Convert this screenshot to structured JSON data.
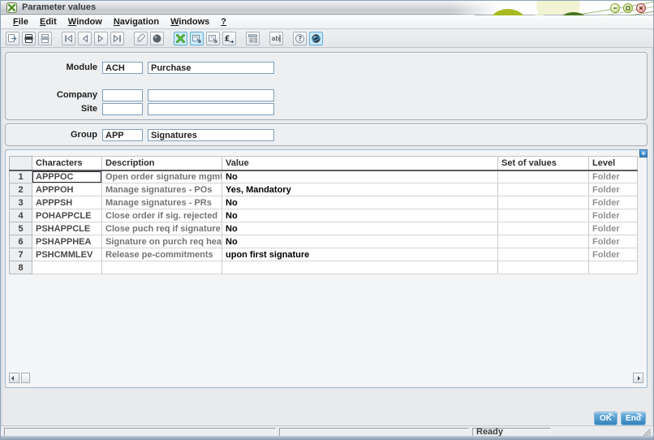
{
  "window": {
    "title": "Parameter values",
    "controls": {
      "minimize": "minimize",
      "maximize": "maximize",
      "close": "close"
    }
  },
  "menu": {
    "items": [
      "File",
      "Edit",
      "Window",
      "Navigation",
      "Windows",
      "?"
    ]
  },
  "toolbar": {
    "items": [
      {
        "name": "exit",
        "selected": false
      },
      {
        "name": "print",
        "selected": false
      },
      {
        "name": "print-list",
        "selected": false
      },
      {
        "name": "first-record",
        "selected": false
      },
      {
        "name": "previous-record",
        "selected": false
      },
      {
        "name": "next-record",
        "selected": false
      },
      {
        "name": "last-record",
        "selected": false
      },
      {
        "name": "attachments",
        "selected": false
      },
      {
        "name": "quick-help",
        "selected": false
      },
      {
        "name": "criteria",
        "selected": true
      },
      {
        "name": "selection-window",
        "selected": true
      },
      {
        "name": "copy-window",
        "selected": false
      },
      {
        "name": "currency-conversion",
        "selected": false
      },
      {
        "name": "list",
        "selected": false
      },
      {
        "name": "text-edit",
        "selected": false
      },
      {
        "name": "help",
        "selected": false
      },
      {
        "name": "web",
        "selected": true
      }
    ]
  },
  "form": {
    "module": {
      "label": "Module",
      "code": "ACH",
      "description": "Purchase"
    },
    "company": {
      "label": "Company",
      "code": "",
      "description": ""
    },
    "site": {
      "label": "Site",
      "code": "",
      "description": ""
    },
    "group": {
      "label": "Group",
      "code": "APP",
      "description": "Signatures"
    }
  },
  "table": {
    "columns": [
      "",
      "Characters",
      "Description",
      "Value",
      "Set of values",
      "Level"
    ],
    "rows": [
      {
        "num": "1",
        "characters": "APPPOC",
        "description": "Open order signature mgmt",
        "value": "No",
        "set_of_values": "",
        "level": "Folder"
      },
      {
        "num": "2",
        "characters": "APPPOH",
        "description": "Manage signatures - POs",
        "value": "Yes, Mandatory",
        "set_of_values": "",
        "level": "Folder"
      },
      {
        "num": "3",
        "characters": "APPPSH",
        "description": "Manage signatures - PRs",
        "value": "No",
        "set_of_values": "",
        "level": "Folder"
      },
      {
        "num": "4",
        "characters": "POHAPPCLE",
        "description": "Close order if sig. rejected",
        "value": "No",
        "set_of_values": "",
        "level": "Folder"
      },
      {
        "num": "5",
        "characters": "PSHAPPCLE",
        "description": "Close puch req if signature re",
        "value": "No",
        "set_of_values": "",
        "level": "Folder"
      },
      {
        "num": "6",
        "characters": "PSHAPPHEA",
        "description": "Signature on purch req header",
        "value": "No",
        "set_of_values": "",
        "level": "Folder"
      },
      {
        "num": "7",
        "characters": "PSHCMMLEV",
        "description": "Release pe-commitments",
        "value": "upon first signature",
        "set_of_values": "",
        "level": "Folder"
      },
      {
        "num": "8",
        "characters": "",
        "description": "",
        "value": "",
        "set_of_values": "",
        "level": ""
      }
    ],
    "expand_icon": "+"
  },
  "buttons": {
    "ok": "OK",
    "end": "End"
  },
  "status": {
    "message": "Ready"
  },
  "colors": {
    "accent_lime": "#a9ba1f",
    "accent_dark_green": "#47751f",
    "toolbar_selected": "#cde9f6",
    "action_button_blue": "#3584bc",
    "close_red": "#b5524a",
    "grid_focus": "#26282c"
  }
}
